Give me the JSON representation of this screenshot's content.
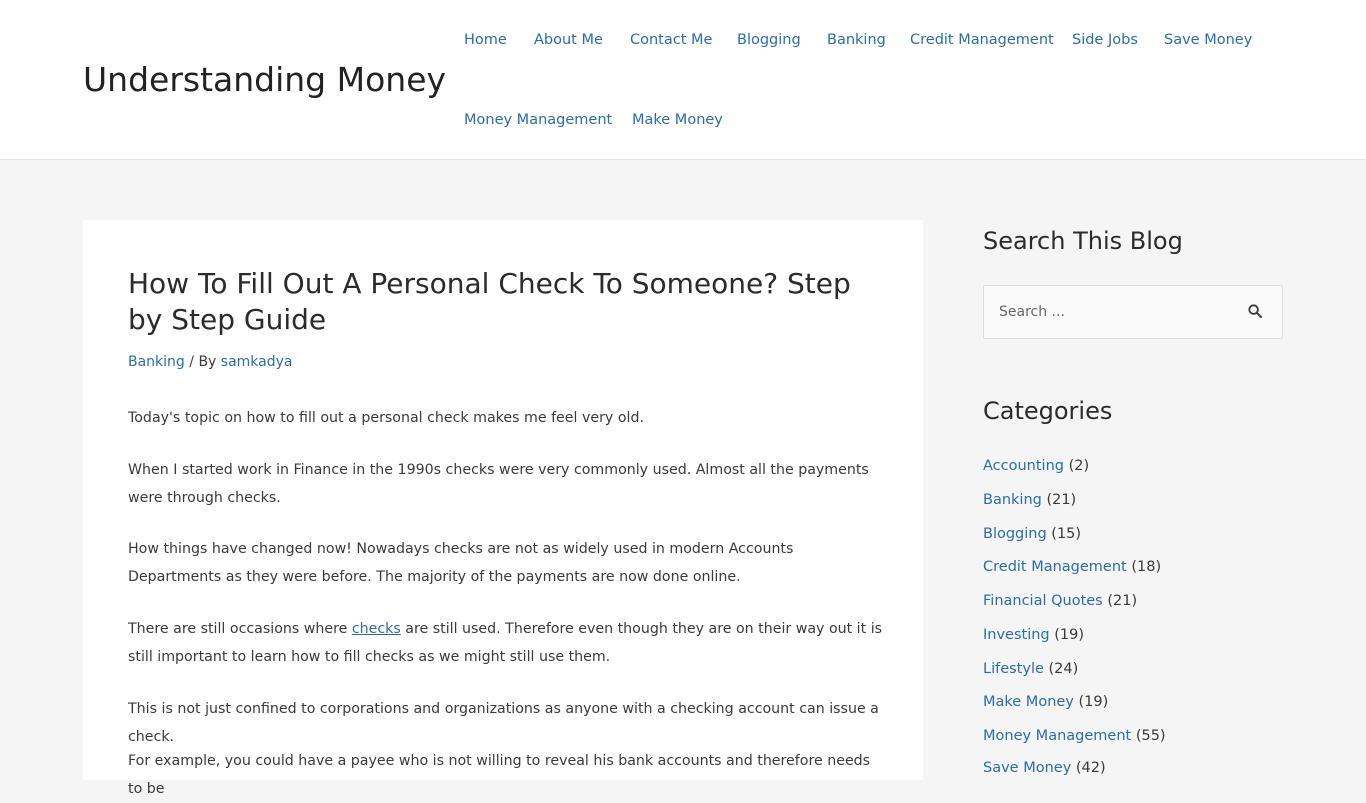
{
  "header": {
    "site_title": "Understanding Money",
    "nav": [
      {
        "label": "Home"
      },
      {
        "label": "About Me"
      },
      {
        "label": "Contact Me"
      },
      {
        "label": "Blogging"
      },
      {
        "label": "Banking"
      },
      {
        "label": "Credit Management"
      },
      {
        "label": "Side Jobs"
      },
      {
        "label": "Save Money"
      },
      {
        "label": "Money Management"
      },
      {
        "label": "Make Money"
      }
    ]
  },
  "article": {
    "title": "How To Fill Out A Personal Check To Someone? Step by Step Guide",
    "meta": {
      "category": "Banking",
      "separator": " / By ",
      "author": "samkadya"
    },
    "paragraphs": {
      "p1": "Today's topic on how to fill out a personal check makes me feel very old.",
      "p2": "When I started work in Finance in the 1990s checks were very commonly used. Almost all the payments were through checks.",
      "p3": "How things have changed now! Nowadays checks are not as widely used in modern Accounts Departments as they were before. The majority of the payments are now done online.",
      "p4_before": "There are still occasions where ",
      "p4_link": "checks",
      "p4_after": " are still used. Therefore even though they are on their way out it is still important to learn how to fill checks as we might still use them.",
      "p5": "This is not just confined to corporations and organizations as anyone with a checking account can issue a check.",
      "p6": "For example, you could have a payee who is not willing to reveal his bank accounts and therefore needs to be"
    }
  },
  "sidebar": {
    "search": {
      "title": "Search This Blog",
      "placeholder": "Search ...",
      "button_icon": "search-icon"
    },
    "categories": {
      "title": "Categories",
      "items": [
        {
          "name": "Accounting",
          "count": "(2)"
        },
        {
          "name": "Banking",
          "count": "(21)"
        },
        {
          "name": "Blogging",
          "count": "(15)"
        },
        {
          "name": "Credit Management",
          "count": "(18)"
        },
        {
          "name": "Financial Quotes",
          "count": "(21)"
        },
        {
          "name": "Investing",
          "count": "(19)"
        },
        {
          "name": "Lifestyle",
          "count": "(24)"
        },
        {
          "name": "Make Money",
          "count": "(19)"
        },
        {
          "name": "Money Management",
          "count": "(55)"
        },
        {
          "name": "Save Money",
          "count": "(42)"
        }
      ]
    }
  },
  "colors": {
    "link": "#2b6da8",
    "text": "#3a3a3a",
    "page_background": "#f5f5f5",
    "card_background": "#ffffff"
  }
}
